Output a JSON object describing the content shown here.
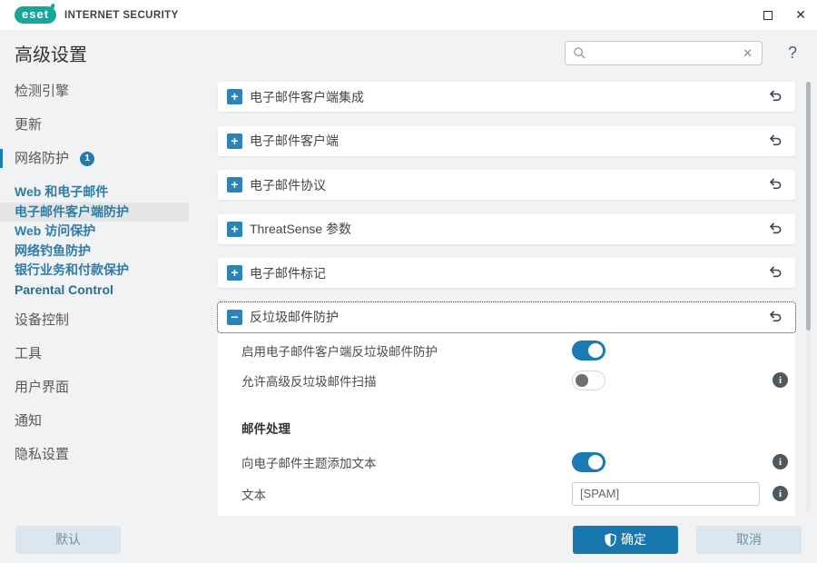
{
  "titlebar": {
    "brand": "eset",
    "product": "INTERNET SECURITY"
  },
  "header": {
    "title": "高级设置",
    "search": {
      "value": "",
      "placeholder": ""
    }
  },
  "sidebar": {
    "items": [
      {
        "label": "检测引擎"
      },
      {
        "label": "更新"
      },
      {
        "label": "网络防护",
        "badge": "1",
        "active": true
      },
      {
        "label": "Web 和电子邮件"
      },
      {
        "label": "电子邮件客户端防护",
        "selected": true
      },
      {
        "label": "Web 访问保护"
      },
      {
        "label": "网络钓鱼防护"
      },
      {
        "label": "银行业务和付款保护"
      },
      {
        "label": "Parental Control"
      },
      {
        "label": "设备控制"
      },
      {
        "label": "工具"
      },
      {
        "label": "用户界面"
      },
      {
        "label": "通知"
      },
      {
        "label": "隐私设置"
      }
    ]
  },
  "main": {
    "sections": [
      {
        "title": "电子邮件客户端集成",
        "state": "collapsed"
      },
      {
        "title": "电子邮件客户端",
        "state": "collapsed"
      },
      {
        "title": "电子邮件协议",
        "state": "collapsed"
      },
      {
        "title": "ThreatSense 参数",
        "state": "collapsed"
      },
      {
        "title": "电子邮件标记",
        "state": "collapsed"
      },
      {
        "title": "反垃圾邮件防护",
        "state": "expanded"
      }
    ],
    "antispam_panel": {
      "rows": [
        {
          "label": "启用电子邮件客户端反垃圾邮件防护",
          "toggle": "on",
          "info": false
        },
        {
          "label": "允许高级反垃圾邮件扫描",
          "toggle": "off",
          "info": true
        }
      ],
      "group_heading": "邮件处理",
      "subject_row": {
        "label": "向电子邮件主题添加文本",
        "toggle": "on",
        "info": true
      },
      "text_row": {
        "label": "文本",
        "value": "[SPAM]",
        "info": true
      }
    }
  },
  "footer": {
    "default": "默认",
    "ok": "确定",
    "cancel": "取消"
  },
  "icons": {
    "maximize": "□",
    "close": "✕",
    "search": "magnifier",
    "search_clear": "✕",
    "help": "?",
    "expand": "+",
    "collapse": "−",
    "revert": "undo-arrow",
    "info": "i",
    "ok_shield": "shield"
  },
  "colors": {
    "accent_blue": "#1e7cb1",
    "brand_teal": "#17a79a",
    "link_blue": "#2f7ca6",
    "window_bg": "#f0f2f3",
    "card_bg": "#ffffff",
    "light_button_bg": "#dbe6ee",
    "light_button_text": "#7191a6",
    "toggle_on": "#1b7ab2",
    "info_gray": "#4f585e"
  }
}
